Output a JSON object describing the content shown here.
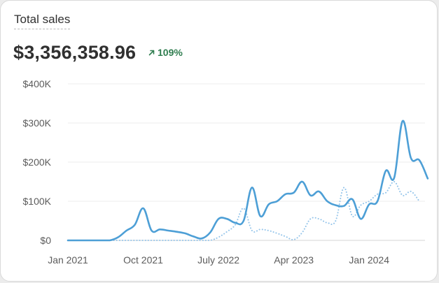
{
  "card": {
    "title": "Total sales",
    "total": "$3,356,358.96",
    "change": "109%",
    "change_icon": "arrow-up-right-icon",
    "colors": {
      "current": "#4d9fd6",
      "previous": "#93c4ea",
      "positive": "#2f7d4f"
    }
  },
  "chart_data": {
    "type": "line",
    "title": "Total sales",
    "ylim": [
      0,
      400000
    ],
    "y_ticks": [
      "$0",
      "$100K",
      "$200K",
      "$300K",
      "$400K"
    ],
    "y_tick_values": [
      0,
      100000,
      200000,
      300000,
      400000
    ],
    "x_ticks": [
      "Jan 2021",
      "Oct 2021",
      "July 2022",
      "Apr 2023",
      "Jan 2024"
    ],
    "x_tick_dates": [
      "2021-01",
      "2021-10",
      "2022-07",
      "2023-04",
      "2024-01"
    ],
    "grid": true,
    "series": [
      {
        "style": "solid",
        "points": [
          [
            "2021-01",
            0
          ],
          [
            "2021-02",
            0
          ],
          [
            "2021-03",
            0
          ],
          [
            "2021-04",
            0
          ],
          [
            "2021-05",
            0
          ],
          [
            "2021-06",
            0
          ],
          [
            "2021-07",
            8000
          ],
          [
            "2021-08",
            25000
          ],
          [
            "2021-09",
            40000
          ],
          [
            "2021-10",
            82000
          ],
          [
            "2021-11",
            25000
          ],
          [
            "2021-12",
            28000
          ],
          [
            "2022-01",
            25000
          ],
          [
            "2022-02",
            22000
          ],
          [
            "2022-03",
            18000
          ],
          [
            "2022-04",
            10000
          ],
          [
            "2022-05",
            5000
          ],
          [
            "2022-06",
            20000
          ],
          [
            "2022-07",
            55000
          ],
          [
            "2022-08",
            55000
          ],
          [
            "2022-09",
            45000
          ],
          [
            "2022-10",
            50000
          ],
          [
            "2022-11",
            135000
          ],
          [
            "2022-12",
            62000
          ],
          [
            "2023-01",
            92000
          ],
          [
            "2023-02",
            100000
          ],
          [
            "2023-03",
            118000
          ],
          [
            "2023-04",
            122000
          ],
          [
            "2023-05",
            150000
          ],
          [
            "2023-06",
            115000
          ],
          [
            "2023-07",
            125000
          ],
          [
            "2023-08",
            100000
          ],
          [
            "2023-09",
            90000
          ],
          [
            "2023-10",
            88000
          ],
          [
            "2023-11",
            105000
          ],
          [
            "2023-12",
            55000
          ],
          [
            "2024-01",
            92000
          ],
          [
            "2024-02",
            100000
          ],
          [
            "2024-03",
            178000
          ],
          [
            "2024-04",
            160000
          ],
          [
            "2024-05",
            305000
          ],
          [
            "2024-06",
            210000
          ],
          [
            "2024-07",
            205000
          ],
          [
            "2024-08",
            158000
          ]
        ]
      },
      {
        "style": "dotted",
        "points": [
          [
            "2021-01",
            0
          ],
          [
            "2021-02",
            0
          ],
          [
            "2021-03",
            0
          ],
          [
            "2021-04",
            0
          ],
          [
            "2021-05",
            0
          ],
          [
            "2021-06",
            0
          ],
          [
            "2021-07",
            0
          ],
          [
            "2021-08",
            0
          ],
          [
            "2021-09",
            0
          ],
          [
            "2021-10",
            0
          ],
          [
            "2021-11",
            0
          ],
          [
            "2021-12",
            0
          ],
          [
            "2022-01",
            0
          ],
          [
            "2022-02",
            0
          ],
          [
            "2022-03",
            0
          ],
          [
            "2022-04",
            0
          ],
          [
            "2022-05",
            0
          ],
          [
            "2022-06",
            0
          ],
          [
            "2022-07",
            8000
          ],
          [
            "2022-08",
            22000
          ],
          [
            "2022-09",
            40000
          ],
          [
            "2022-10",
            82000
          ],
          [
            "2022-11",
            25000
          ],
          [
            "2022-12",
            28000
          ],
          [
            "2023-01",
            25000
          ],
          [
            "2023-02",
            18000
          ],
          [
            "2023-03",
            10000
          ],
          [
            "2023-04",
            2000
          ],
          [
            "2023-05",
            20000
          ],
          [
            "2023-06",
            55000
          ],
          [
            "2023-07",
            55000
          ],
          [
            "2023-08",
            45000
          ],
          [
            "2023-09",
            50000
          ],
          [
            "2023-10",
            135000
          ],
          [
            "2023-11",
            62000
          ],
          [
            "2023-12",
            90000
          ],
          [
            "2024-01",
            100000
          ],
          [
            "2024-02",
            118000
          ],
          [
            "2024-03",
            122000
          ],
          [
            "2024-04",
            150000
          ],
          [
            "2024-05",
            115000
          ],
          [
            "2024-06",
            125000
          ],
          [
            "2024-07",
            100000
          ]
        ]
      }
    ]
  }
}
